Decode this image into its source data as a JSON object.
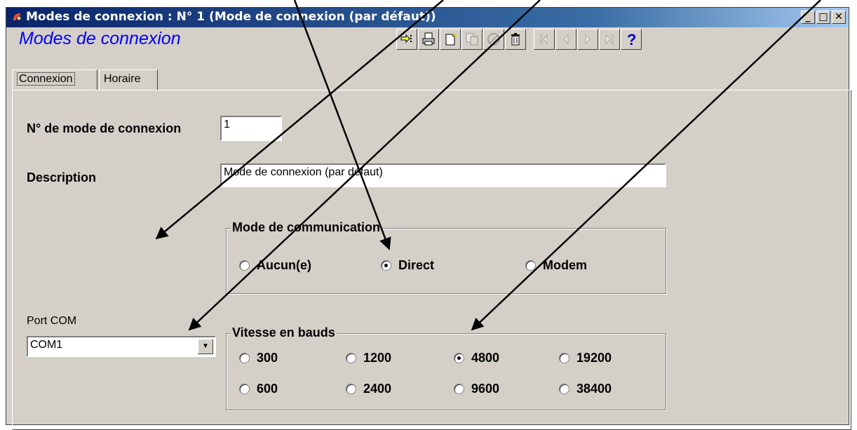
{
  "window": {
    "title": "Modes de connexion : N° 1 (Mode de connexion (par défaut))",
    "heading": "Modes de connexion",
    "controls": [
      "_",
      "□",
      "✕"
    ]
  },
  "toolbar": {
    "buttons": [
      {
        "name": "select-icon",
        "enabled": true
      },
      {
        "name": "print-icon",
        "enabled": true
      },
      {
        "name": "new-icon",
        "enabled": true
      },
      {
        "name": "copy-icon",
        "enabled": false
      },
      {
        "name": "cancel-icon",
        "enabled": false
      },
      {
        "name": "delete-icon",
        "enabled": true
      },
      {
        "name": "first-icon",
        "enabled": false
      },
      {
        "name": "previous-icon",
        "enabled": false
      },
      {
        "name": "next-icon",
        "enabled": false
      },
      {
        "name": "last-icon",
        "enabled": false
      },
      {
        "name": "help-icon",
        "enabled": true
      }
    ]
  },
  "tabs": [
    {
      "label": "Connexion",
      "active": true
    },
    {
      "label": "Horaire",
      "active": false
    }
  ],
  "form": {
    "number_label": "N° de mode de connexion",
    "number_value": "1",
    "description_label": "Description",
    "description_value": "Mode de connexion (par défaut)",
    "comm_mode": {
      "title": "Mode de communication",
      "options": [
        "Aucun(e)",
        "Direct",
        "Modem"
      ],
      "selected": "Direct"
    },
    "port": {
      "label": "Port COM",
      "value": "COM1"
    },
    "baud": {
      "title": "Vitesse en bauds",
      "options": [
        "300",
        "1200",
        "4800",
        "19200",
        "600",
        "2400",
        "9600",
        "38400"
      ],
      "selected": "4800"
    }
  },
  "colors": {
    "heading": "#0000ff",
    "titlebar_start": "#0a246a",
    "window_bg": "#d4d0c8"
  }
}
